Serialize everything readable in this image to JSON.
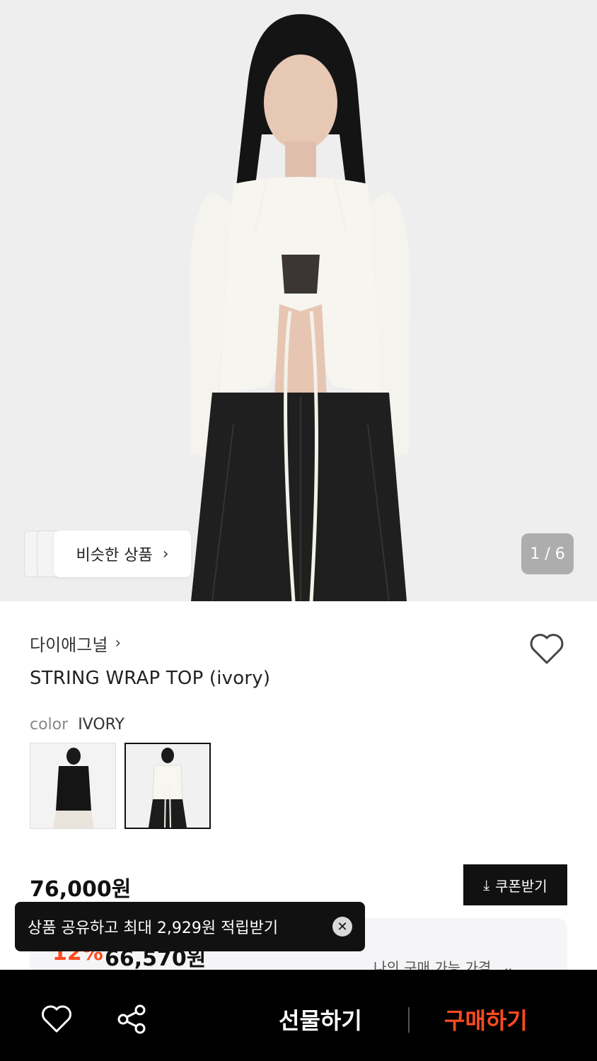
{
  "gallery": {
    "similar_label": "비슷한 상품",
    "counter": "1 / 6"
  },
  "product": {
    "brand": "다이애그널",
    "title": "STRING WRAP TOP (ivory)",
    "color_label": "color",
    "color_value": "IVORY",
    "swatches": [
      "black",
      "ivory"
    ],
    "price": "76,000원",
    "coupon_label": "쿠폰받기",
    "discount_rate": "12%",
    "discount_price": "66,570원",
    "my_price_label": "나의 구매 가능 가격"
  },
  "toast": {
    "message": "상품 공유하고 최대 2,929원 적립받기"
  },
  "bottom_bar": {
    "gift_label": "선물하기",
    "buy_label": "구매하기"
  },
  "colors": {
    "accent": "#ff4b1f",
    "dark": "#111111"
  }
}
